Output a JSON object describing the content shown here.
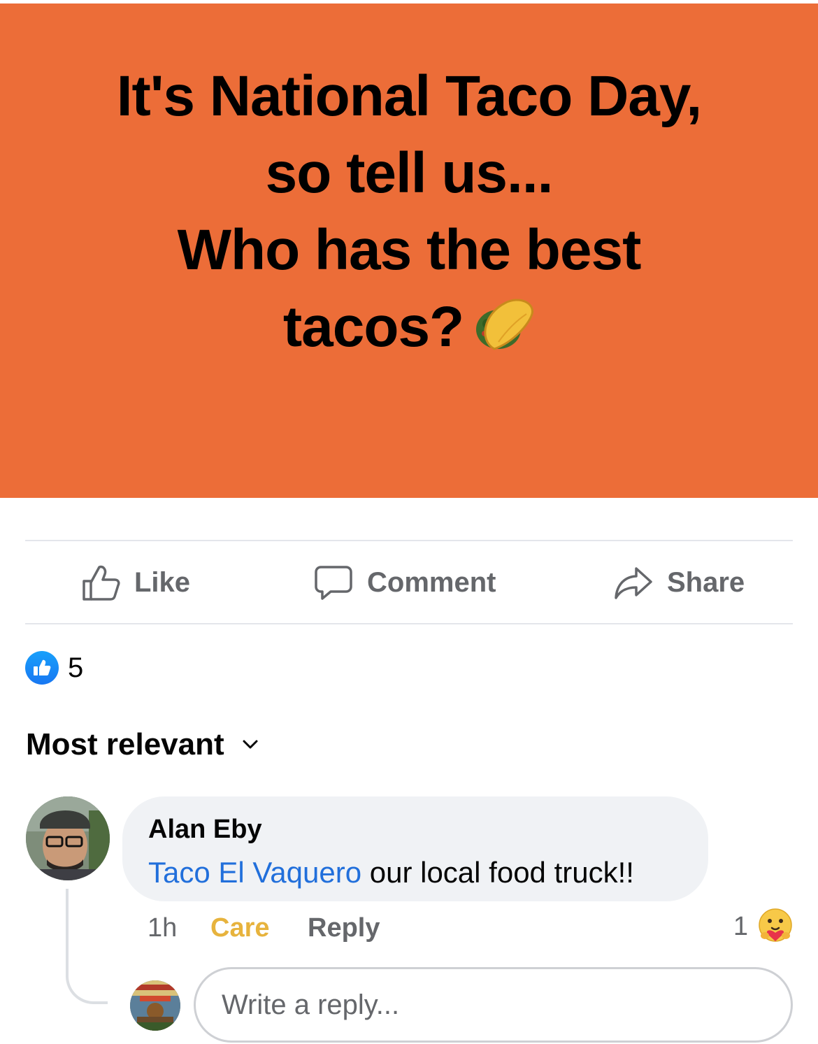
{
  "post": {
    "line1": "It's National Taco Day,",
    "line2": "so tell us...",
    "line3": "Who has the best",
    "line4": "tacos?",
    "background_color": "#ec6d38",
    "emoji": "taco-emoji"
  },
  "actions": {
    "like_label": "Like",
    "comment_label": "Comment",
    "share_label": "Share"
  },
  "reactions": {
    "type": "like",
    "count": "5"
  },
  "sort": {
    "label": "Most relevant"
  },
  "comment": {
    "author": "Alan Eby",
    "mention": "Taco El Vaquero",
    "text": " our local food truck!!",
    "time": "1h",
    "reaction_label": "Care",
    "reply_label": "Reply",
    "reaction_count": "1",
    "reaction_icon": "care-emoji-icon"
  },
  "reply_box": {
    "placeholder": "Write a reply..."
  },
  "colors": {
    "link": "#216fdb",
    "care": "#e7b33d",
    "secondary_text": "#65676b"
  }
}
